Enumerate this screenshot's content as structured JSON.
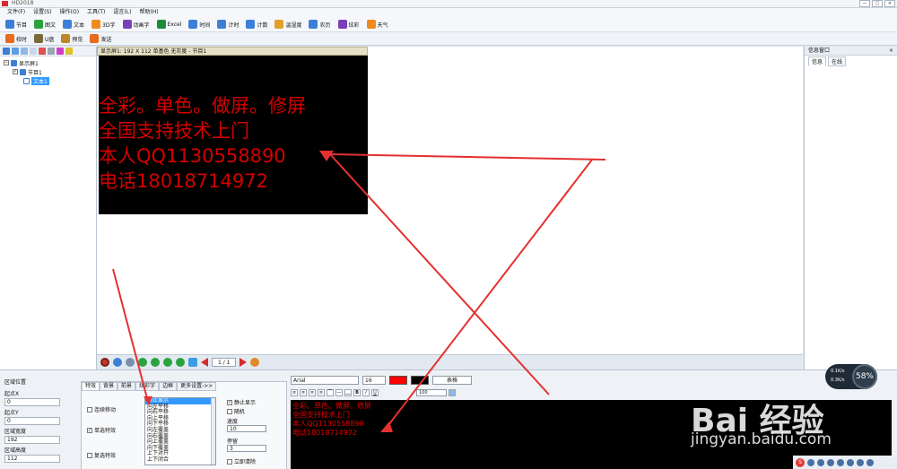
{
  "app": {
    "title": "HD2018",
    "window_buttons": [
      "—",
      "□",
      "×"
    ]
  },
  "menu": [
    "文件(F)",
    "设置(S)",
    "操作(O)",
    "工具(T)",
    "语言(L)",
    "帮助(H)"
  ],
  "toolbar": [
    {
      "label": "节目",
      "color": "#3c7fd6"
    },
    {
      "label": "图文",
      "color": "#2aa33f"
    },
    {
      "label": "文本",
      "color": "#3c7fd6"
    },
    {
      "label": "3D字",
      "color": "#f08a1c"
    },
    {
      "label": "动画字",
      "color": "#7b3fb8"
    },
    {
      "label": "Excel",
      "color": "#1e8a3c"
    },
    {
      "label": "时间",
      "color": "#3c7fd6"
    },
    {
      "label": "计时",
      "color": "#3c7fd6"
    },
    {
      "label": "计数",
      "color": "#3c7fd6"
    },
    {
      "label": "温湿度",
      "color": "#e2a02a"
    },
    {
      "label": "农历",
      "color": "#3c7fd6"
    },
    {
      "label": "炫彩",
      "color": "#7b3fb8"
    },
    {
      "label": "天气",
      "color": "#f08a1c"
    }
  ],
  "toolbar2": [
    {
      "label": "校时",
      "color": "#e86a1c"
    },
    {
      "label": "U盘",
      "color": "#7a6a3a"
    },
    {
      "label": "预览",
      "color": "#c0862a"
    },
    {
      "label": "发送",
      "color": "#e86a1c"
    }
  ],
  "tree": {
    "root": "显示屏1",
    "program": "节目1",
    "text": "文本1"
  },
  "screen": {
    "caption": "显示屏1: 192 X 112  单基色 无灰度 - 节目1",
    "lines": [
      "全彩。单色。做屏。修屏",
      "全国支持技术上门",
      "本人QQ1130558890",
      "电话18018714972"
    ]
  },
  "info_panel": {
    "title": "信息窗口",
    "close": "×",
    "tabs": [
      "信息",
      "在线"
    ]
  },
  "playback": {
    "page": "1 / 1"
  },
  "region": {
    "title": "区域位置",
    "fields": [
      {
        "label": "起点X",
        "value": "0"
      },
      {
        "label": "起点Y",
        "value": "0"
      },
      {
        "label": "区域宽度",
        "value": "192"
      },
      {
        "label": "区域高度",
        "value": "112"
      }
    ]
  },
  "effects": {
    "tabs": [
      "特效",
      "背景",
      "前景",
      "炫彩字",
      "边框",
      "更多设置->>"
    ],
    "continuous_move": "连续移动",
    "single_effect": "单选特效",
    "multi_effect": "复选特效",
    "effect_list": [
      "静止显示",
      "向左平移",
      "向右平移",
      "向上平移",
      "向下平移",
      "向左覆盖",
      "向右覆盖",
      "向上覆盖",
      "向下覆盖",
      "上下对开",
      "上下闭合"
    ],
    "static_display": "静止显示",
    "random": "随机",
    "speed_label": "速度",
    "speed_value": "10",
    "stay_label": "停留",
    "stay_value": "3",
    "clear_now": "立即清除"
  },
  "font": {
    "family": "Arial",
    "size": "16",
    "fg_color": "#ff0000",
    "bg_color": "#000000",
    "table_button": "表格",
    "format_buttons": [
      "B",
      "I",
      "U"
    ],
    "scale": "100"
  },
  "preview_lines": [
    "全彩。单色。做屏。修屏",
    "全国支持技术上门",
    "本人QQ1130558890",
    "电话18018714972"
  ],
  "net_widget": {
    "up": "0.1K/s",
    "down": "0.3K/s",
    "percent": "58%"
  },
  "watermark": {
    "brand": "Bai 经验",
    "url": "jingyan.baidu.com"
  }
}
